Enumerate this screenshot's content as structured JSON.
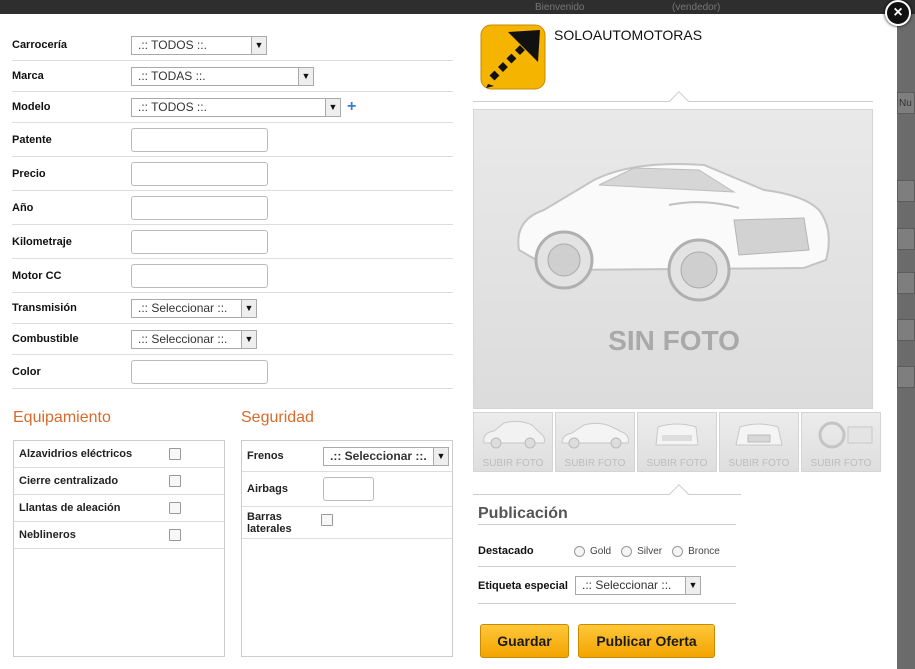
{
  "background": {
    "topbar_left": "Bienvenido",
    "topbar_right": "(vendedor)",
    "side_text": "Nu"
  },
  "modal": {
    "close_label": "×"
  },
  "form": {
    "carroceria": {
      "label": "Carrocería",
      "value": ".:: TODOS ::."
    },
    "marca": {
      "label": "Marca",
      "value": ".:: TODAS ::."
    },
    "modelo": {
      "label": "Modelo",
      "value": ".:: TODOS ::."
    },
    "patente": {
      "label": "Patente",
      "value": ""
    },
    "precio": {
      "label": "Precio",
      "value": ""
    },
    "anio": {
      "label": "Año",
      "value": ""
    },
    "kilometraje": {
      "label": "Kilometraje",
      "value": ""
    },
    "motor": {
      "label": "Motor CC",
      "value": ""
    },
    "transmision": {
      "label": "Transmisión",
      "value": ".:: Seleccionar ::."
    },
    "combustible": {
      "label": "Combustible",
      "value": ".:: Seleccionar ::."
    },
    "color": {
      "label": "Color",
      "value": ""
    }
  },
  "equipamiento": {
    "title": "Equipamiento",
    "items": [
      {
        "label": "Alzavidrios eléctricos"
      },
      {
        "label": "Cierre centralizado"
      },
      {
        "label": "Llantas de aleación"
      },
      {
        "label": "Neblineros"
      }
    ]
  },
  "seguridad": {
    "title": "Seguridad",
    "frenos_label": "Frenos",
    "frenos_value": ".:: Seleccionar ::.",
    "airbags_label": "Airbags",
    "barras_label": "Barras laterales"
  },
  "brand": {
    "name": "SOLOAUTOMOTORAS"
  },
  "photo": {
    "placeholder_text": "SIN FOTO"
  },
  "thumbnails": [
    {
      "label": "SUBIR FOTO"
    },
    {
      "label": "SUBIR FOTO"
    },
    {
      "label": "SUBIR FOTO"
    },
    {
      "label": "SUBIR FOTO"
    },
    {
      "label": "SUBIR FOTO"
    }
  ],
  "publicacion": {
    "title": "Publicación",
    "destacado_label": "Destacado",
    "options": [
      "Gold",
      "Silver",
      "Bronce"
    ],
    "etiqueta_label": "Etiqueta especial",
    "etiqueta_value": ".:: Seleccionar ::."
  },
  "buttons": {
    "guardar": "Guardar",
    "publicar": "Publicar Oferta"
  },
  "colors": {
    "accent_orange": "#d86b2c",
    "button_yellow": "#f3a400",
    "link_blue": "#3a7bd5"
  }
}
